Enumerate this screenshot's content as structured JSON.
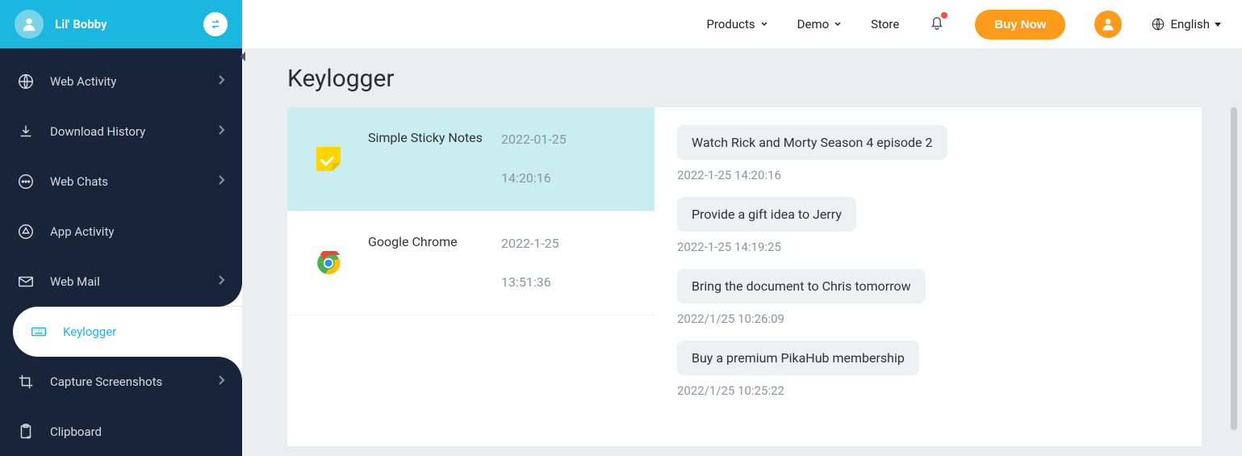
{
  "profile": {
    "name": "Lil' Bobby"
  },
  "sidebar": {
    "items": [
      {
        "label": "Web Activity"
      },
      {
        "label": "Download History"
      },
      {
        "label": "Web Chats"
      },
      {
        "label": "App Activity"
      },
      {
        "label": "Web Mail"
      },
      {
        "label": "Keylogger"
      },
      {
        "label": "Capture Screenshots"
      },
      {
        "label": "Clipboard"
      }
    ]
  },
  "topnav": {
    "products": "Products",
    "demo": "Demo",
    "store": "Store",
    "buy": "Buy Now",
    "language": "English"
  },
  "page": {
    "title": "Keylogger"
  },
  "apps": [
    {
      "name": "Simple Sticky Notes",
      "date": "2022-01-25",
      "time": "14:20:16"
    },
    {
      "name": "Google Chrome",
      "date": "2022-1-25",
      "time": "13:51:36"
    }
  ],
  "log": [
    {
      "text": "Watch Rick and Morty Season 4 episode 2",
      "ts": "2022-1-25 14:20:16"
    },
    {
      "text": "Provide a gift idea to Jerry",
      "ts": "2022-1-25 14:19:25"
    },
    {
      "text": "Bring the document to Chris tomorrow",
      "ts": "2022/1/25 10:26:09"
    },
    {
      "text": "Buy a premium PikaHub membership",
      "ts": "2022/1/25 10:25:22"
    }
  ]
}
